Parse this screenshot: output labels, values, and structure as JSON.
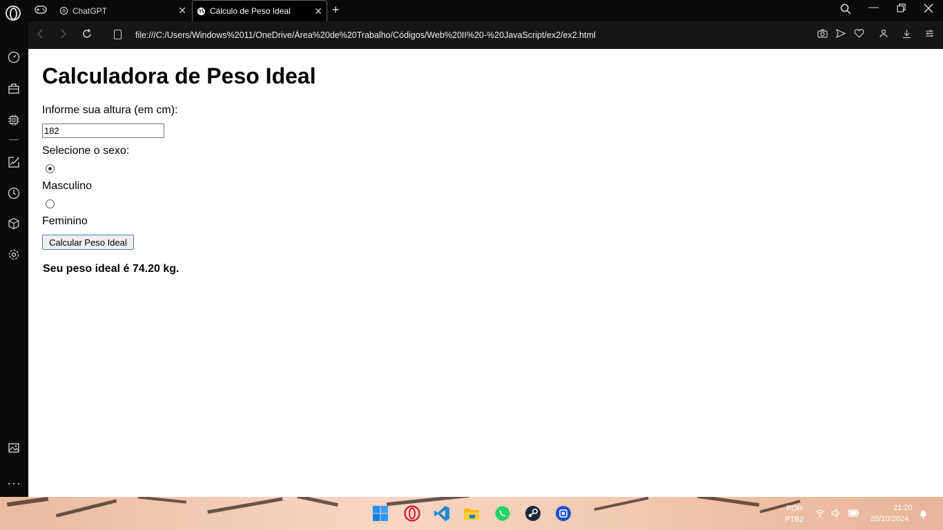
{
  "browser": {
    "tabs": [
      {
        "label": "ChatGPT",
        "active": false
      },
      {
        "label": "Cálculo de Peso Ideal",
        "active": true
      }
    ],
    "url": "file:///C:/Users/Windows%2011/OneDrive/Área%20de%20Trabalho/Códigos/Web%20II%20-%20JavaScript/ex2/ex2.html"
  },
  "page": {
    "title": "Calculadora de Peso Ideal",
    "height_label": "Informe sua altura (em cm):",
    "height_value": "182",
    "sex_label": "Selecione o sexo:",
    "options": [
      {
        "label": "Masculino",
        "checked": true
      },
      {
        "label": "Feminino",
        "checked": false
      }
    ],
    "button_label": "Calcular Peso Ideal",
    "result": "Seu peso ideal é 74.20 kg."
  },
  "taskbar": {
    "lang_top": "POR",
    "lang_bottom": "PTB2",
    "time": "21:20",
    "date": "20/10/2024"
  }
}
